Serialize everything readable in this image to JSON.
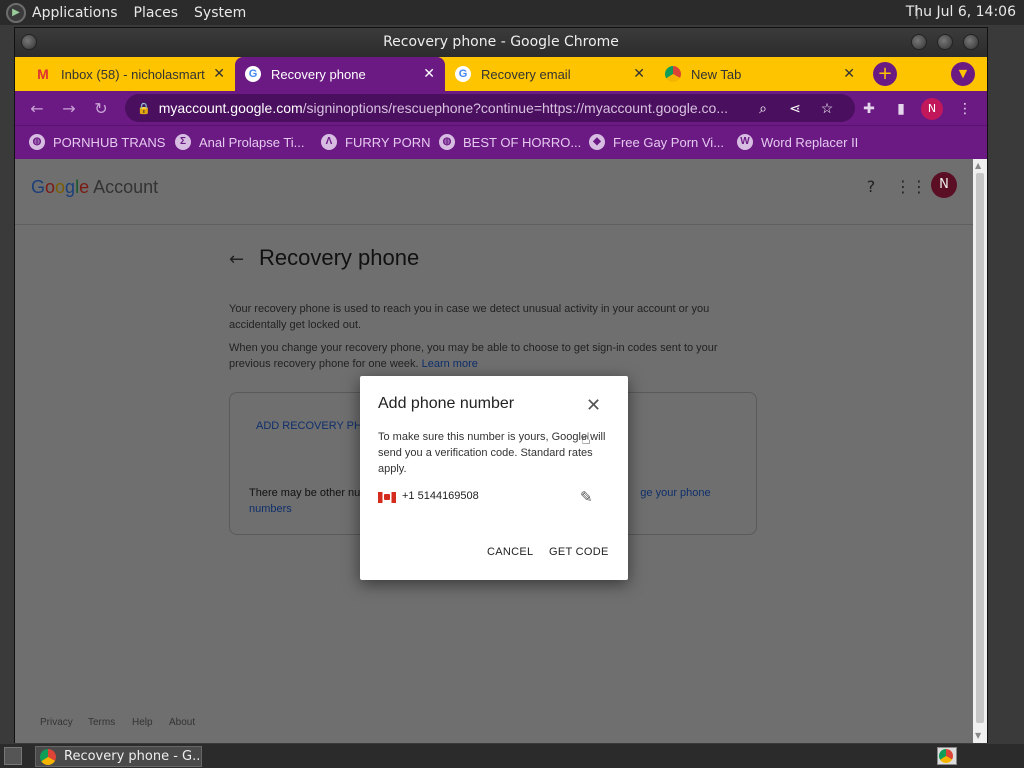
{
  "system": {
    "menus": [
      "Applications",
      "Places",
      "System"
    ],
    "clock": "Thu Jul  6, 14:06"
  },
  "window": {
    "title": "Recovery phone - Google Chrome"
  },
  "tabs": [
    {
      "title": "Inbox (58) - nicholasmart",
      "favicon": "gmail-icon",
      "active": false
    },
    {
      "title": "Recovery phone",
      "favicon": "google-icon",
      "active": true
    },
    {
      "title": "Recovery email",
      "favicon": "google-icon",
      "active": false
    },
    {
      "title": "New Tab",
      "favicon": "chrome-icon",
      "active": false
    }
  ],
  "tab_close_glyph": "✕",
  "omnibox": {
    "host": "myaccount.google.com",
    "path": "/signinoptions/rescuephone?continue=https://myaccount.google.co..."
  },
  "profile_initial": "N",
  "bookmarks": [
    {
      "label": "PORNHUB TRANS"
    },
    {
      "label": "Anal Prolapse Ti..."
    },
    {
      "label": "FURRY PORN"
    },
    {
      "label": "BEST OF HORRO..."
    },
    {
      "label": "Free Gay Porn Vi..."
    },
    {
      "label": "Word Replacer II"
    }
  ],
  "page": {
    "logo_google": "Google",
    "logo_account": "Account",
    "title": "Recovery phone",
    "para1": "Your recovery phone is used to reach you in case we detect unusual activity in your account or you accidentally get locked out.",
    "para2_text": "When you change your recovery phone, you may be able to choose to get sign-in codes sent to your previous recovery phone for one week. ",
    "para2_link": "Learn more",
    "add_recovery": "ADD RECOVERY PHO",
    "note_text": "There may be other nu",
    "note_link": "ge your phone",
    "note_link2": "numbers",
    "footer": [
      "Privacy",
      "Terms",
      "Help",
      "About"
    ]
  },
  "dialog": {
    "title": "Add phone number",
    "body": "To make sure this number is yours, Google will send you a verification code. Standard rates apply.",
    "phone": "+1 5144169508",
    "cancel": "CANCEL",
    "get_code": "GET CODE"
  },
  "taskbar": {
    "window_label": "Recovery phone - G..."
  }
}
